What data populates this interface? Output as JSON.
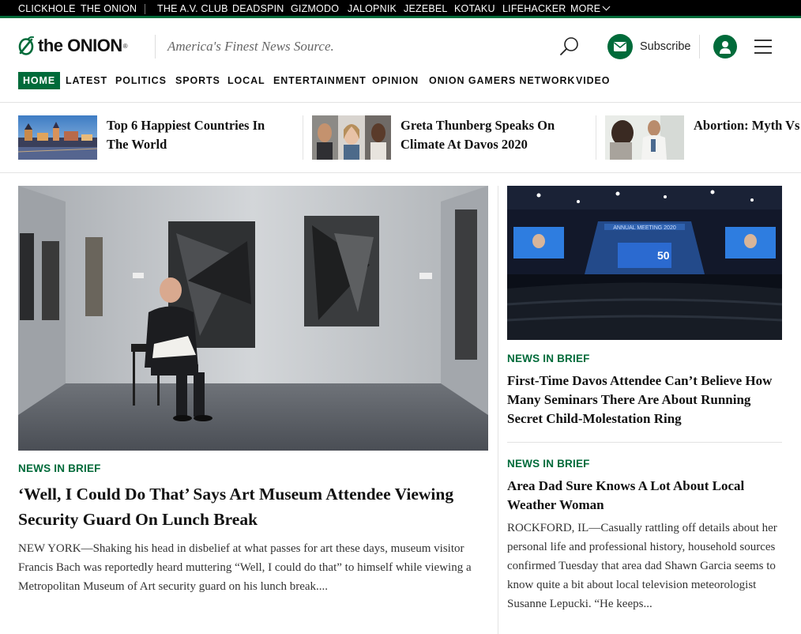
{
  "network": {
    "items": [
      "CLICKHOLE",
      "THE ONION",
      "THE A.V. CLUB",
      "DEADSPIN",
      "GIZMODO",
      "JALOPNIK",
      "JEZEBEL",
      "KOTAKU",
      "LIFEHACKER"
    ],
    "more_label": "MORE"
  },
  "header": {
    "logo_text": "the ONION",
    "logo_reg": "®",
    "tagline": "America's Finest News Source.",
    "subscribe_label": "Subscribe",
    "brand_color": "#006b3a"
  },
  "sections": [
    "HOME",
    "LATEST",
    "POLITICS",
    "SPORTS",
    "LOCAL",
    "ENTERTAINMENT",
    "OPINION",
    "ONION GAMERS NETWORK",
    "VIDEO"
  ],
  "trending": [
    {
      "line1": "Top 6 Happiest Countries In",
      "line2": "The World"
    },
    {
      "line1": "Greta Thunberg Speaks On",
      "line2": "Climate At Davos 2020"
    },
    {
      "line1": "Abortion: Myth Vs",
      "line2": ""
    }
  ],
  "main_story": {
    "kicker": "NEWS IN BRIEF",
    "title": "‘Well, I Could Do That’ Says Art Museum Attendee Viewing Security Guard On Lunch Break",
    "body": "NEW YORK—Shaking his head in disbelief at what passes for art these days, museum visitor Francis Bach was reportedly heard muttering “Well, I could do that” to himself while viewing a Metropolitan Museum of Art security guard on his lunch break...."
  },
  "side_stories": [
    {
      "kicker": "NEWS IN BRIEF",
      "title": "First-Time Davos Attendee Can’t Believe How Many Seminars There Are About Running Secret Child-Molestation Ring",
      "image_caption": "ANNUAL MEETING 2020",
      "image_badge": "50"
    },
    {
      "kicker": "NEWS IN BRIEF",
      "title": "Area Dad Sure Knows A Lot About Local Weather Woman",
      "body": "ROCKFORD, IL—Casually rattling off details about her personal life and professional history, household sources confirmed Tuesday that area dad Shawn Garcia seems to know quite a bit about local television meteorologist Susanne Lepucki. “He keeps..."
    }
  ]
}
